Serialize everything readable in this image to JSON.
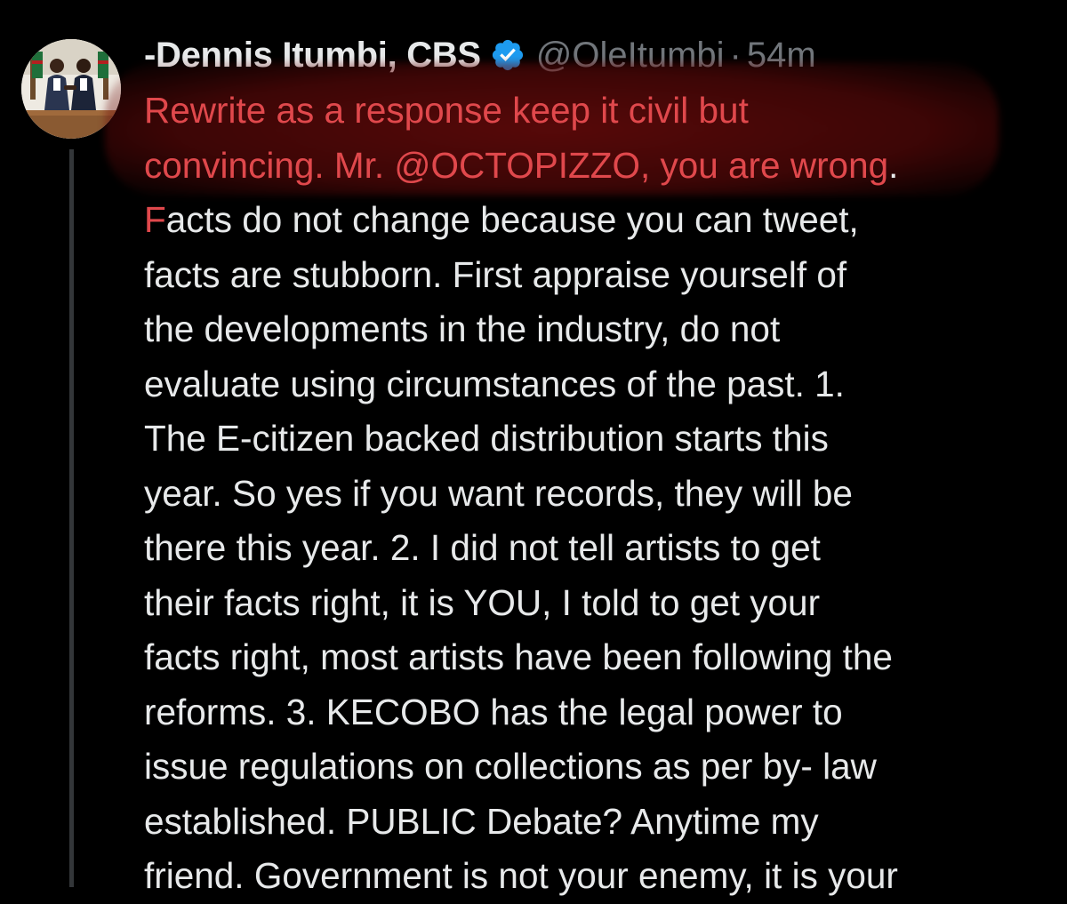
{
  "tweet": {
    "author": {
      "display_name": "-Dennis Itumbi, CBS",
      "handle": "@OleItumbi",
      "verified": true,
      "avatar_icon": "profile-photo-icon"
    },
    "separator": "·",
    "timestamp": "54m",
    "body_lines": [
      {
        "red": "Rewrite as a response keep it civil but",
        "rest": ""
      },
      {
        "red": "convincing. Mr. @OCTOPIZZO, you are wrong",
        "rest": "."
      },
      {
        "red": "F",
        "rest": "acts do not change because you can tweet,"
      },
      {
        "red": "",
        "rest": "facts are stubborn. First appraise yourself of"
      },
      {
        "red": "",
        "rest": "the developments in the industry, do not"
      },
      {
        "red": "",
        "rest": "evaluate using circumstances of the past. 1."
      },
      {
        "red": "",
        "rest": "The E-citizen backed distribution starts this"
      },
      {
        "red": "",
        "rest": "year. So yes if you want records, they will be"
      },
      {
        "red": "",
        "rest": "there this year. 2. I did not tell artists to get"
      },
      {
        "red": "",
        "rest": "their facts right, it is YOU, I told to get your"
      },
      {
        "red": "",
        "rest": "facts right, most artists have been following the"
      },
      {
        "red": "",
        "rest": "reforms. 3. KECOBO has the legal power to"
      },
      {
        "red": "",
        "rest": "issue regulations on collections as per by- law"
      },
      {
        "red": "",
        "rest": "established. PUBLIC Debate? Anytime my"
      },
      {
        "red": "",
        "rest": "friend. Government is not your enemy, it is your"
      }
    ]
  },
  "colors": {
    "background": "#000000",
    "text_primary": "#e7e9ea",
    "text_secondary": "#71767b",
    "verified_blue": "#1d9bf0",
    "highlight_red": "#e0484c"
  }
}
